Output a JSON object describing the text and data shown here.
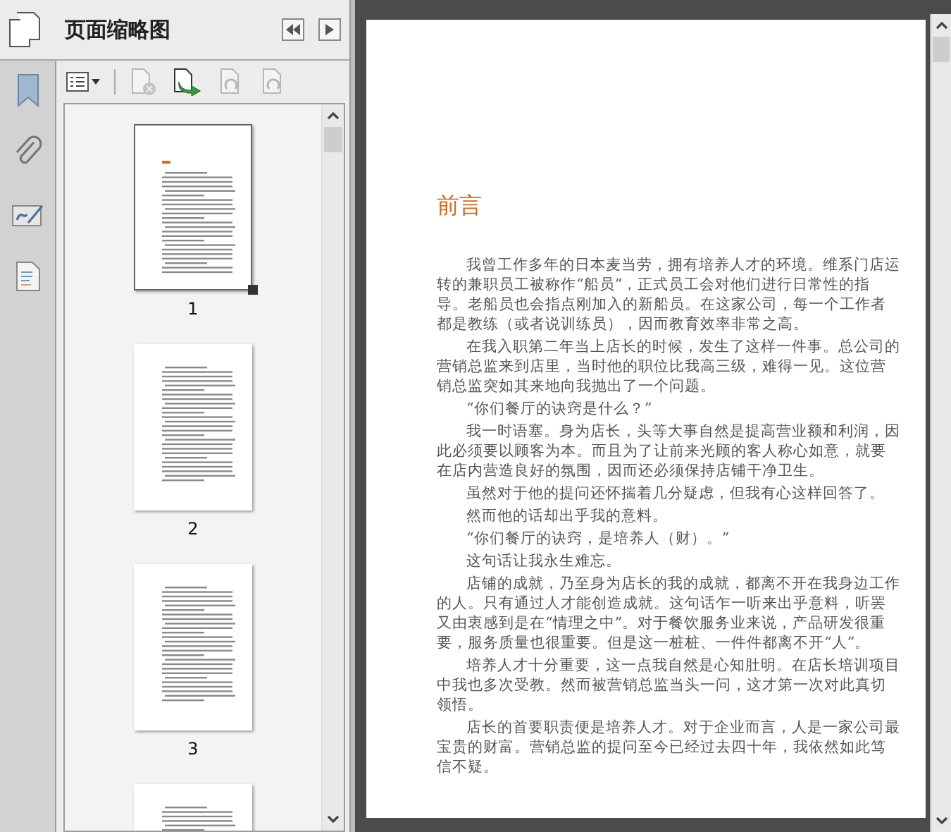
{
  "panel": {
    "title": "页面缩略图"
  },
  "toolbar": [
    {
      "kind": "options",
      "disabled": false
    },
    {
      "kind": "delete",
      "disabled": true
    },
    {
      "kind": "insert",
      "disabled": false
    },
    {
      "kind": "rotate-left",
      "disabled": true
    },
    {
      "kind": "rotate-right",
      "disabled": true
    }
  ],
  "sidebar": {
    "items": [
      {
        "kind": "bookmark"
      },
      {
        "kind": "attachment"
      },
      {
        "kind": "signature"
      },
      {
        "kind": "content"
      }
    ]
  },
  "thumbnails": [
    {
      "label": "1",
      "selected": true,
      "heading": true
    },
    {
      "label": "2",
      "selected": false,
      "heading": false
    },
    {
      "label": "3",
      "selected": false,
      "heading": false
    },
    {
      "selected": false,
      "heading": false
    }
  ],
  "document": {
    "title": "前言",
    "paragraphs": [
      "我曾工作多年的日本麦当劳，拥有培养人才的环境。维系门店运转的兼职员工被称作“船员”，正式员工会对他们进行日常性的指导。老船员也会指点刚加入的新船员。在这家公司，每一个工作者都是教练（或者说训练员），因而教育效率非常之高。",
      "在我入职第二年当上店长的时候，发生了这样一件事。总公司的营销总监来到店里，当时他的职位比我高三级，难得一见。这位营销总监突如其来地向我抛出了一个问题。",
      "“你们餐厅的诀窍是什么？”",
      "我一时语塞。身为店长，头等大事自然是提高营业额和利润，因此必须要以顾客为本。而且为了让前来光顾的客人称心如意，就要在店内营造良好的氛围，因而还必须保持店铺干净卫生。",
      "虽然对于他的提问还怀揣着几分疑虑，但我有心这样回答了。",
      "然而他的话却出乎我的意料。",
      "“你们餐厅的诀窍，是培养人（财）。”",
      "这句话让我永生难忘。",
      "店铺的成就，乃至身为店长的我的成就，都离不开在我身边工作的人。只有通过人才能创造成就。这句话乍一听来出乎意料，听罢又由衷感到是在“情理之中”。对于餐饮服务业来说，产品研发很重要，服务质量也很重要。但是这一桩桩、一件件都离不开“人”。",
      "培养人才十分重要，这一点我自然是心知肚明。在店长培训项目中我也多次受教。然而被营销总监当头一问，这才第一次对此真切领悟。",
      "店长的首要职责便是培养人才。对于企业而言，人是一家公司最宝贵的财富。营销总监的提问至今已经过去四十年，我依然如此笃信不疑。"
    ]
  }
}
